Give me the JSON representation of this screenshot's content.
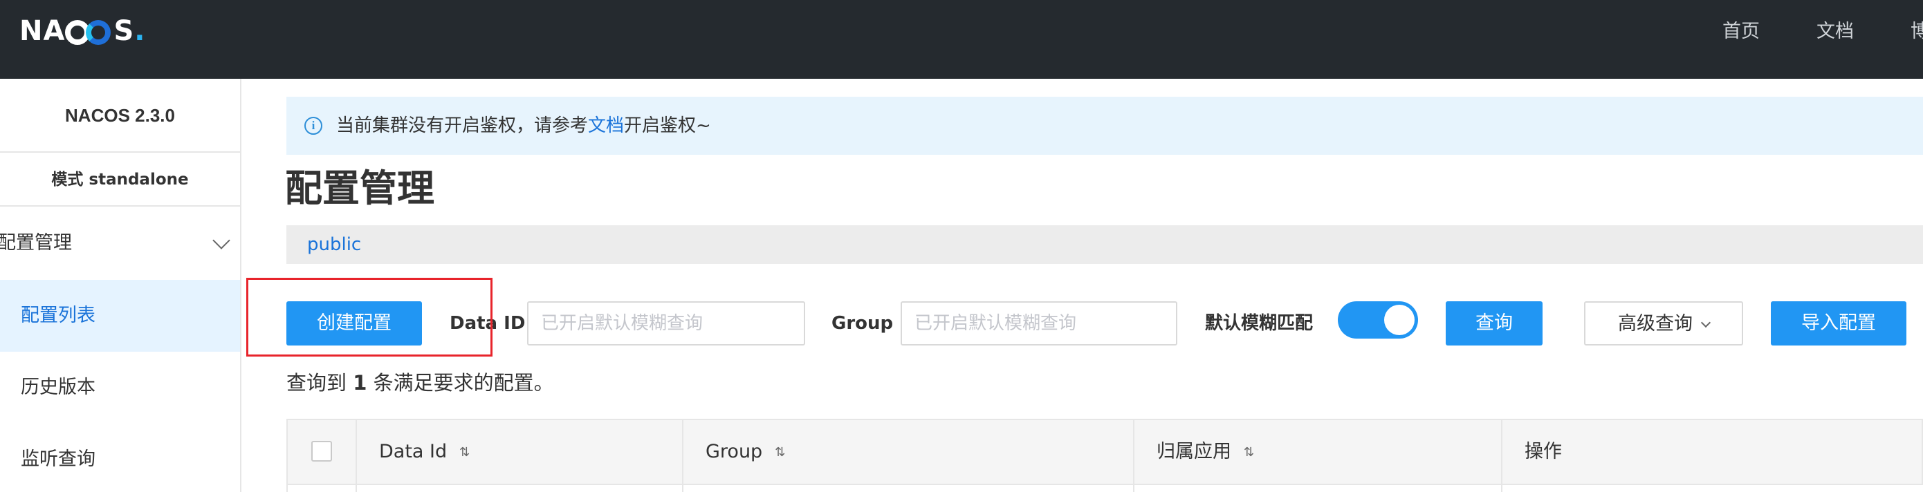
{
  "header": {
    "logo_text": "NACOS",
    "nav": [
      "首页",
      "文档",
      "博"
    ]
  },
  "sidebar": {
    "version": "NACOS 2.3.0",
    "mode": "模式 standalone",
    "group_label": "配置管理",
    "items": [
      {
        "label": "配置列表",
        "active": true
      },
      {
        "label": "历史版本",
        "active": false
      },
      {
        "label": "监听查询",
        "active": false
      }
    ]
  },
  "notice": {
    "text_before": "当前集群没有开启鉴权，请参考",
    "link": "文档",
    "text_after": "开启鉴权~"
  },
  "page_title": "配置管理",
  "namespace": "public",
  "toolbar": {
    "create_label": "创建配置",
    "data_id_label": "Data ID",
    "data_id_placeholder": "已开启默认模糊查询",
    "group_label": "Group",
    "group_placeholder": "已开启默认模糊查询",
    "fuzzy_label": "默认模糊匹配",
    "fuzzy_enabled": true,
    "query_label": "查询",
    "advanced_label": "高级查询",
    "import_label": "导入配置"
  },
  "summary": {
    "prefix": "查询到 ",
    "count": "1",
    "suffix": " 条满足要求的配置。"
  },
  "table": {
    "columns": [
      "Data Id",
      "Group",
      "归属应用",
      "操作"
    ]
  },
  "colors": {
    "header_bg": "#252a2f",
    "primary": "#2196f3",
    "link": "#1a73d9",
    "highlight": "#e8242b"
  }
}
